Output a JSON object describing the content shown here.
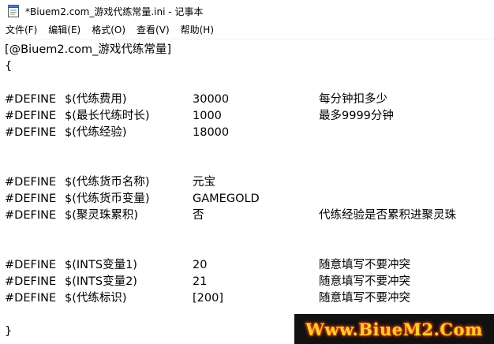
{
  "window": {
    "title": "*Biuem2.com_游戏代练常量.ini - 记事本",
    "icon": "notepad-icon"
  },
  "menu": [
    {
      "label": "文件(F)"
    },
    {
      "label": "编辑(E)"
    },
    {
      "label": "格式(O)"
    },
    {
      "label": "查看(V)"
    },
    {
      "label": "帮助(H)"
    }
  ],
  "editor": {
    "lines": [
      {
        "cols": [
          "[@Biuem2.com_游戏代练常量]",
          "",
          "",
          ""
        ]
      },
      {
        "cols": [
          "{",
          "",
          "",
          ""
        ]
      },
      {
        "cols": [
          "",
          "",
          "",
          ""
        ]
      },
      {
        "cols": [
          "#DEFINE",
          "$(代练费用)",
          "30000",
          "每分钟扣多少"
        ]
      },
      {
        "cols": [
          "#DEFINE",
          "$(最长代练时长)",
          "1000",
          "最多9999分钟"
        ]
      },
      {
        "cols": [
          "#DEFINE",
          "$(代练经验)",
          "18000",
          ""
        ]
      },
      {
        "cols": [
          "",
          "",
          "",
          ""
        ]
      },
      {
        "cols": [
          "",
          "",
          "",
          ""
        ]
      },
      {
        "cols": [
          "#DEFINE",
          "$(代练货币名称)",
          "元宝",
          ""
        ]
      },
      {
        "cols": [
          "#DEFINE",
          "$(代练货币变量)",
          "GAMEGOLD",
          ""
        ]
      },
      {
        "cols": [
          "#DEFINE",
          "$(聚灵珠累积)",
          "否",
          "代练经验是否累积进聚灵珠"
        ]
      },
      {
        "cols": [
          "",
          "",
          "",
          ""
        ]
      },
      {
        "cols": [
          "",
          "",
          "",
          ""
        ]
      },
      {
        "cols": [
          "#DEFINE",
          "$(INTS变量1)",
          "20",
          "随意填写不要冲突"
        ]
      },
      {
        "cols": [
          "#DEFINE",
          "$(INTS变量2)",
          "21",
          "随意填写不要冲突"
        ]
      },
      {
        "cols": [
          "#DEFINE",
          "$(代练标识)",
          "[200]",
          "随意填写不要冲突"
        ]
      },
      {
        "cols": [
          "",
          "",
          "",
          ""
        ]
      },
      {
        "cols": [
          "}",
          "",
          "",
          ""
        ]
      }
    ]
  },
  "watermark": {
    "text": "Www.BiueM2.Com"
  }
}
